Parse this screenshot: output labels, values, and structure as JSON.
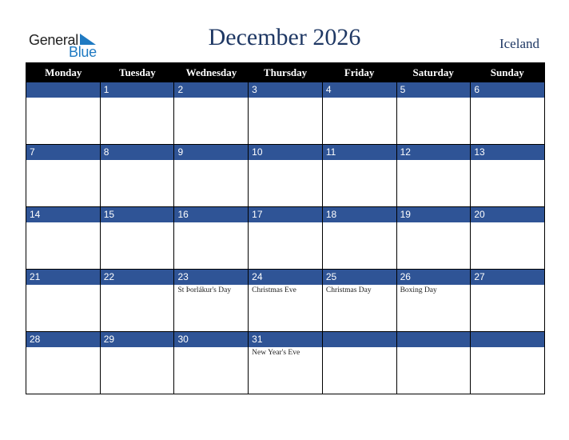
{
  "logo": {
    "line1": "General",
    "line2": "Blue"
  },
  "title": "December 2026",
  "country": "Iceland",
  "colors": {
    "accent": "#2f5496",
    "title": "#1f3864",
    "header_bg": "#000000",
    "logo_blue": "#1f7ac2"
  },
  "weekdays": [
    "Monday",
    "Tuesday",
    "Wednesday",
    "Thursday",
    "Friday",
    "Saturday",
    "Sunday"
  ],
  "weeks": [
    [
      {
        "day": "",
        "event": ""
      },
      {
        "day": "1",
        "event": ""
      },
      {
        "day": "2",
        "event": ""
      },
      {
        "day": "3",
        "event": ""
      },
      {
        "day": "4",
        "event": ""
      },
      {
        "day": "5",
        "event": ""
      },
      {
        "day": "6",
        "event": ""
      }
    ],
    [
      {
        "day": "7",
        "event": ""
      },
      {
        "day": "8",
        "event": ""
      },
      {
        "day": "9",
        "event": ""
      },
      {
        "day": "10",
        "event": ""
      },
      {
        "day": "11",
        "event": ""
      },
      {
        "day": "12",
        "event": ""
      },
      {
        "day": "13",
        "event": ""
      }
    ],
    [
      {
        "day": "14",
        "event": ""
      },
      {
        "day": "15",
        "event": ""
      },
      {
        "day": "16",
        "event": ""
      },
      {
        "day": "17",
        "event": ""
      },
      {
        "day": "18",
        "event": ""
      },
      {
        "day": "19",
        "event": ""
      },
      {
        "day": "20",
        "event": ""
      }
    ],
    [
      {
        "day": "21",
        "event": ""
      },
      {
        "day": "22",
        "event": ""
      },
      {
        "day": "23",
        "event": "St Þorlákur's Day"
      },
      {
        "day": "24",
        "event": "Christmas Eve"
      },
      {
        "day": "25",
        "event": "Christmas Day"
      },
      {
        "day": "26",
        "event": "Boxing Day"
      },
      {
        "day": "27",
        "event": ""
      }
    ],
    [
      {
        "day": "28",
        "event": ""
      },
      {
        "day": "29",
        "event": ""
      },
      {
        "day": "30",
        "event": ""
      },
      {
        "day": "31",
        "event": "New Year's Eve"
      },
      {
        "day": "",
        "event": ""
      },
      {
        "day": "",
        "event": ""
      },
      {
        "day": "",
        "event": ""
      }
    ]
  ]
}
